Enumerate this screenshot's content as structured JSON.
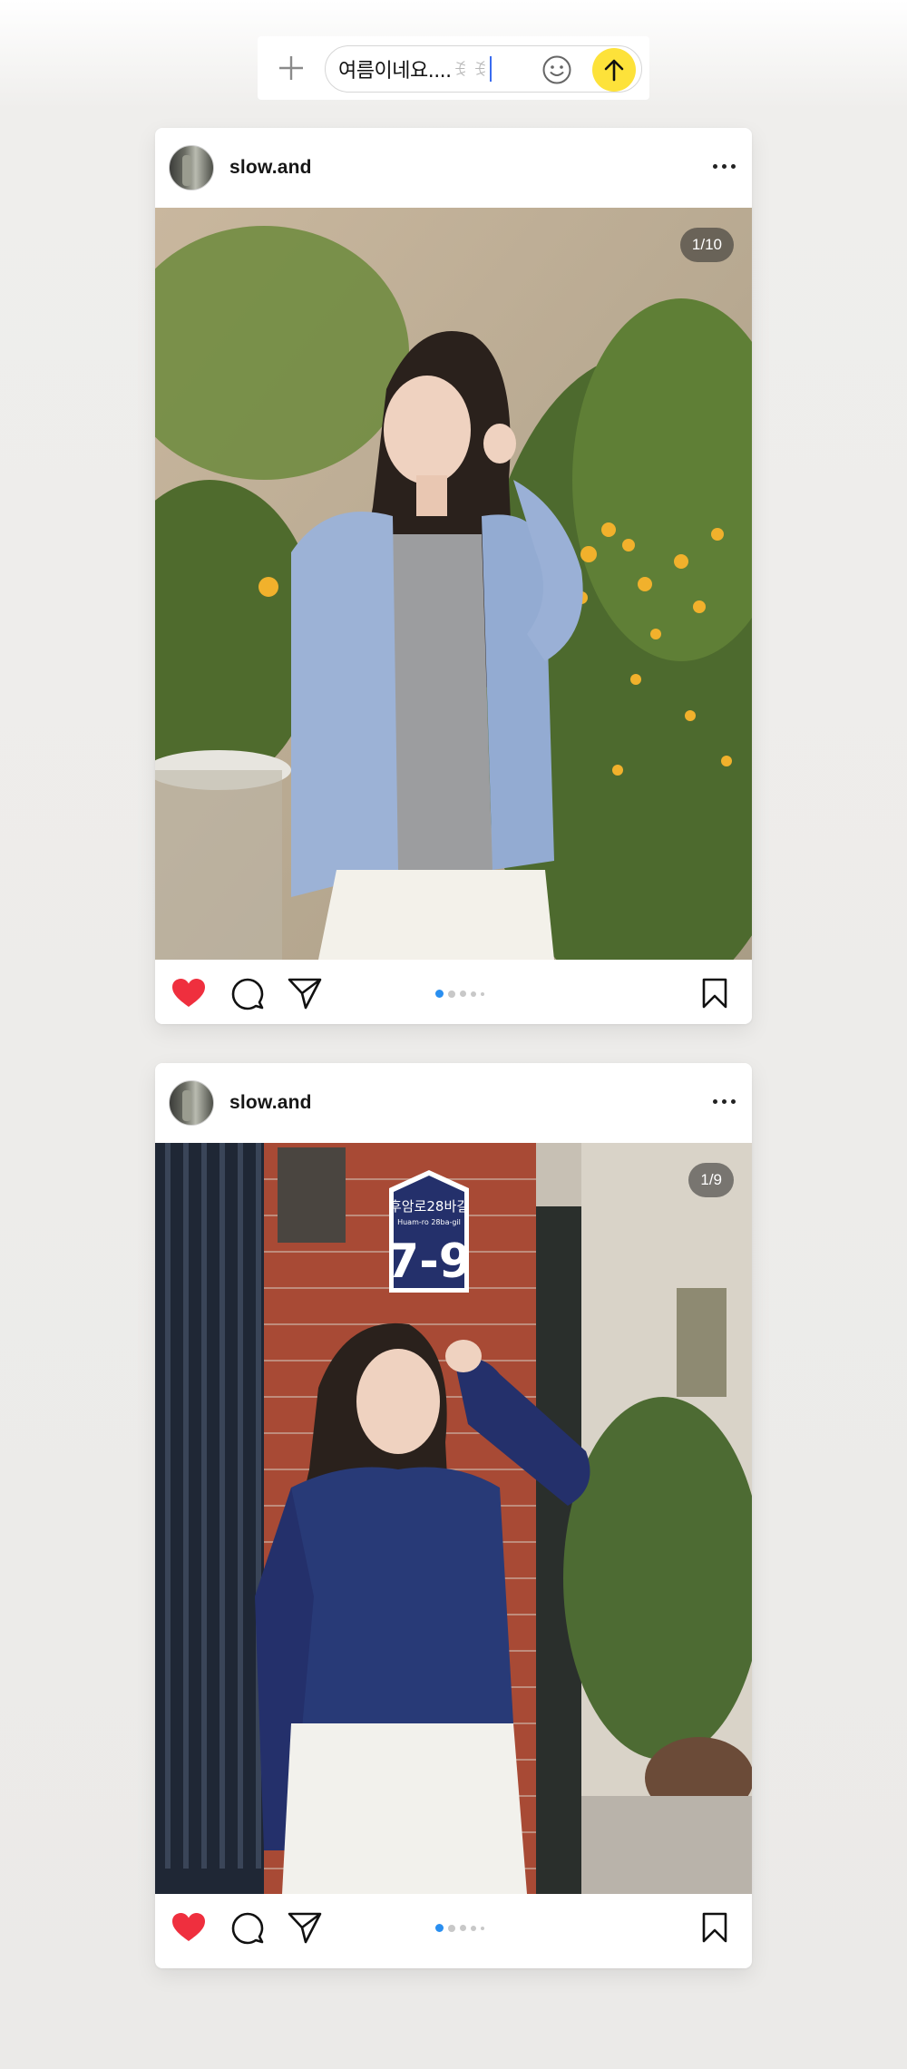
{
  "composer": {
    "text": "여름이네요....",
    "emoji": "ꉂ ꉂ",
    "plus_icon": "plus-icon",
    "smile_icon": "smile-icon",
    "send_icon": "arrow-up-icon",
    "send_color": "#fde23a"
  },
  "posts": [
    {
      "username": "slow.and",
      "counter": "1/10",
      "liked": true,
      "active_dot": 0
    },
    {
      "username": "slow.and",
      "counter": "1/9",
      "liked": true,
      "active_dot": 0
    }
  ],
  "colors": {
    "like": "#ef2f3e",
    "active_dot": "#2a8ff0",
    "background": "#ebeae8"
  },
  "photo2_sign": {
    "korean": "후암로28바길",
    "roman": "Huam-ro 28ba-gil",
    "number": "7-9"
  }
}
